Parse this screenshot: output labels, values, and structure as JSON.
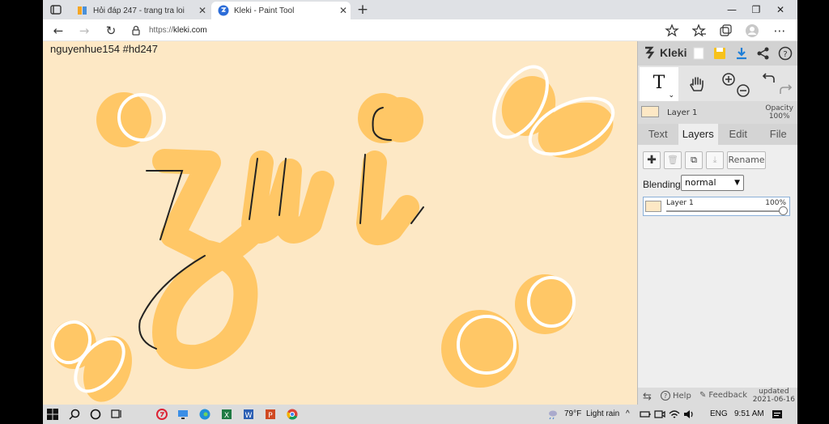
{
  "browser": {
    "tabs": [
      {
        "title": "Hỏi đáp 247 - trang tra loi"
      },
      {
        "title": "Kleki - Paint Tool"
      }
    ],
    "url_prefix": "https://",
    "url_host": "kleki.com"
  },
  "canvas": {
    "watermark": "nguyenhue154  #hd247",
    "background": "#fde8c5",
    "stroke_color": "#ffc766"
  },
  "kleki": {
    "logo": "Kleki",
    "layer_name": "Layer 1",
    "opacity_label": "Opacity",
    "opacity_value": "100%",
    "tabs": [
      "Text",
      "Layers",
      "Edit",
      "File"
    ],
    "active_tab": "Layers",
    "rename_label": "Rename",
    "blending_label": "Blending",
    "blending_value": "normal",
    "layers": [
      {
        "name": "Layer 1",
        "opacity": "100%"
      }
    ],
    "footer": {
      "help": "Help",
      "feedback": "Feedback",
      "updated_label": "updated",
      "updated_date": "2021-06-16"
    }
  },
  "taskbar": {
    "weather_temp": "79°F",
    "weather_text": "Light rain",
    "language": "ENG",
    "time": "9:51 AM"
  }
}
